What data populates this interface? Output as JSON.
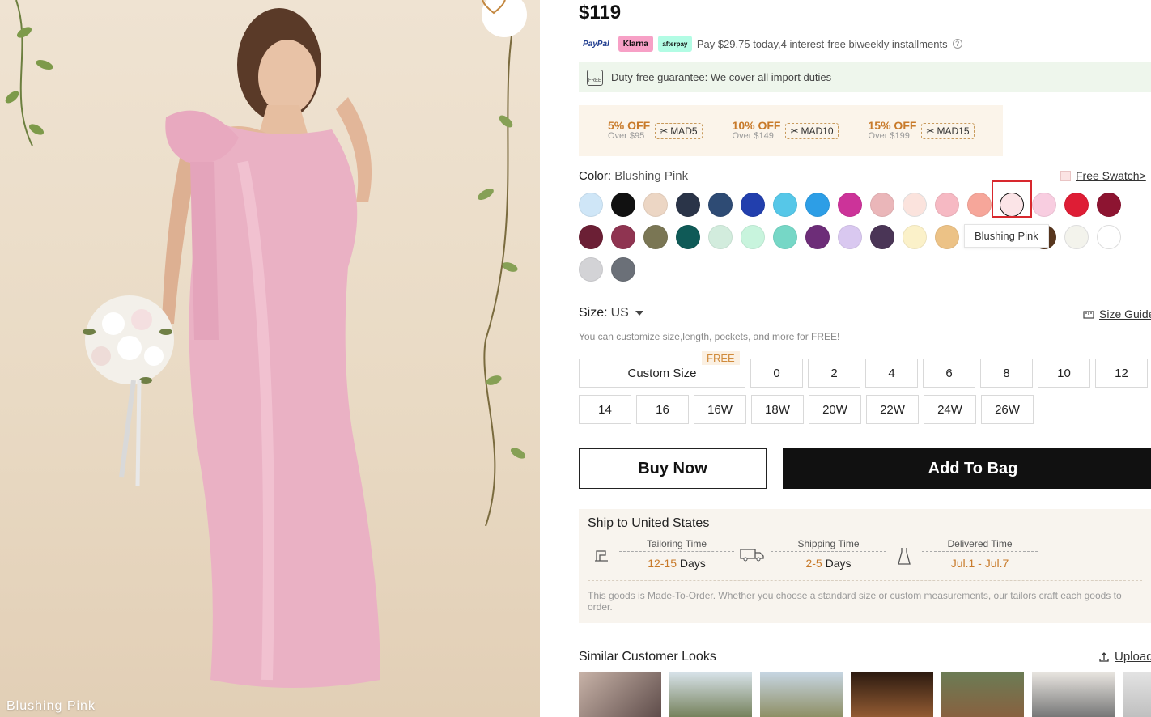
{
  "hero": {
    "caption": "Blushing Pink",
    "favorite_icon": "heart-icon"
  },
  "product": {
    "price": "$119",
    "payment": {
      "logos": [
        "PayPal",
        "Klarna",
        "afterpay"
      ],
      "text": "Pay $29.75 today,4 interest-free biweekly installments",
      "info_icon": "info-icon"
    },
    "duty": {
      "icon_text": "FREE",
      "text": "Duty-free guarantee: We cover all import duties"
    },
    "coupons": [
      {
        "off": "5% OFF",
        "over": "Over $95",
        "code": "MAD5"
      },
      {
        "off": "10% OFF",
        "over": "Over $149",
        "code": "MAD10"
      },
      {
        "off": "15% OFF",
        "over": "Over $199",
        "code": "MAD15"
      }
    ],
    "color": {
      "label": "Color:",
      "selected": "Blushing Pink",
      "free_swatch": "Free Swatch>",
      "tooltip": "Blushing Pink",
      "swatches": [
        "#cfe6f7",
        "#111111",
        "#ecd6c4",
        "#2a3448",
        "#2e4b74",
        "#223fad",
        "#56c7e8",
        "#2d9ee6",
        "#cc3399",
        "#eab6b9",
        "#fbe3dd",
        "#f6b9c3",
        "#f6a69a",
        "#fbe4e7",
        "#f8cde0",
        "#de1d35",
        "#8d1431",
        "#6b1f35",
        "#8f3451",
        "#7a7654",
        "#0f5a57",
        "#d2ecdd",
        "#c8f4dd",
        "#76d7c6",
        "#6d2d78",
        "#d9c8f0",
        "#4a3556",
        "#fbf1c9",
        "#ecc286",
        null,
        null,
        "#58361e",
        "#f3f3ec",
        "#ffffff",
        "#d3d3d6",
        "#6b7078"
      ]
    },
    "size": {
      "label": "Size:",
      "unit": "US",
      "guide": "Size Guide",
      "note": "You can customize size,length, pockets, and more for FREE!",
      "free_tag": "FREE",
      "options": [
        "Custom Size",
        "0",
        "2",
        "4",
        "6",
        "8",
        "10",
        "12",
        "14",
        "16",
        "16W",
        "18W",
        "20W",
        "22W",
        "24W",
        "26W"
      ]
    },
    "actions": {
      "buy_now": "Buy Now",
      "add_to_bag": "Add To Bag"
    },
    "shipping": {
      "title": "Ship to United States",
      "steps": [
        {
          "label": "Tailoring Time",
          "value": "12-15",
          "unit": "Days",
          "icon": "sewing-machine-icon"
        },
        {
          "label": "Shipping Time",
          "value": "2-5",
          "unit": "Days",
          "icon": "truck-icon"
        },
        {
          "label": "Delivered Time",
          "value": "Jul.1 - Jul.7",
          "unit": "",
          "icon": "dress-icon"
        }
      ],
      "note": "This goods is Made-To-Order. Whether you choose a standard size or custom measurements, our tailors craft each goods to order."
    },
    "looks": {
      "title": "Similar Customer Looks",
      "upload": "Upload",
      "upload_icon": "upload-icon"
    }
  }
}
